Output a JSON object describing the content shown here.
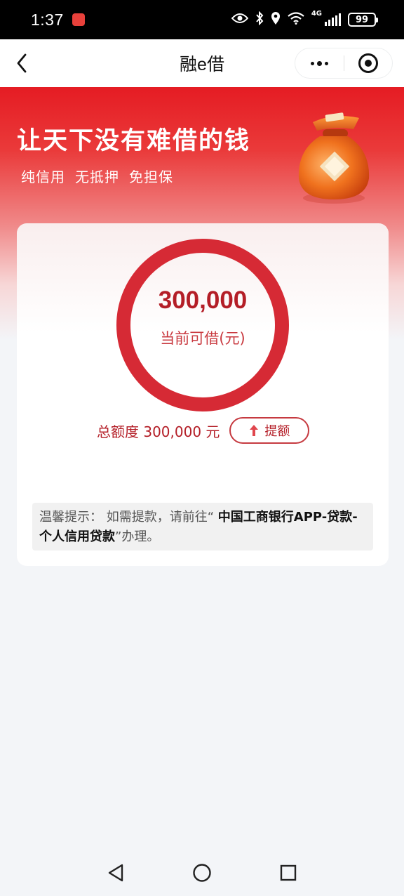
{
  "status_bar": {
    "time": "1:37",
    "network_label": "4G",
    "battery": "99",
    "icons": [
      "app-notification-icon",
      "eye-icon",
      "bluetooth-icon",
      "location-icon",
      "wifi-icon",
      "signal-icon",
      "battery-icon"
    ]
  },
  "nav": {
    "title": "融e借",
    "icons": [
      "back-icon",
      "more-icon",
      "close-mini-program-icon"
    ]
  },
  "hero": {
    "title": "让天下没有难借的钱",
    "tags": [
      "纯信用",
      "无抵押",
      "免担保"
    ],
    "image": "money-bag-icon"
  },
  "credit": {
    "available_amount": "300,000",
    "available_label": "当前可借(元)",
    "total_text": "总额度 300,000 元",
    "raise_button": "提额",
    "accent_color": "#d62a35"
  },
  "notice": {
    "prefix": "温馨提示：  如需提款，请前往“ ",
    "highlight": "中国工商银行APP-贷款-个人信用贷款",
    "suffix": "”办理。"
  },
  "system_nav": {
    "icons": [
      "back-triangle-icon",
      "home-circle-icon",
      "recents-square-icon"
    ]
  }
}
